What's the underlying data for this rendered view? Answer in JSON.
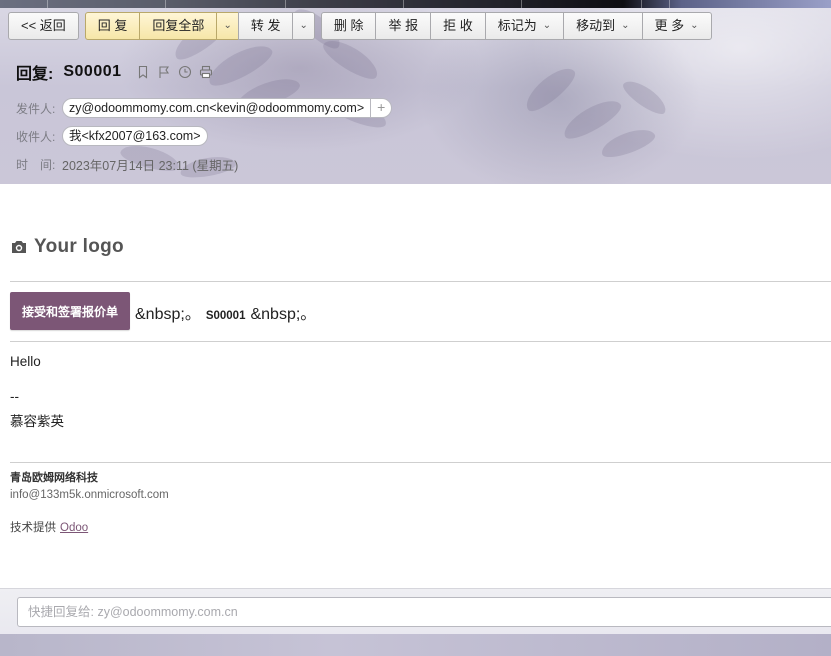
{
  "toolbar": {
    "back": "<< 返回",
    "reply": "回 复",
    "reply_all": "回复全部",
    "forward": "转 发",
    "delete": "删 除",
    "report": "举 报",
    "reject": "拒 收",
    "mark_as": "标记为",
    "move_to": "移动到",
    "more": "更 多",
    "caret": "⌄"
  },
  "mail": {
    "title_prefix": "回复:",
    "subject": "S00001",
    "icons": [
      "bookmark-icon",
      "flag-icon",
      "clock-icon",
      "print-icon"
    ],
    "from_label": "发件人:",
    "from_value": "zy@odoommomy.com.cn<kevin@odoommomy.com>",
    "add": "+",
    "to_label": "收件人:",
    "to_value": "我<kfx2007@163.com>",
    "time_label": "时　间:",
    "time_value": "2023年07月14日 23:11 (星期五)"
  },
  "body": {
    "logo_text": "Your logo",
    "accept_button": "接受和签署报价单",
    "nbsp_before": "&nbsp;。",
    "order_ref": "S00001",
    "nbsp_after": "&nbsp;。",
    "greeting": "Hello",
    "sig_dash": "--",
    "sig_name": "慕容紫英",
    "company_name": "青岛欧姆网络科技",
    "company_email": "info@133m5k.onmicrosoft.com",
    "powered_prefix": "技术提供",
    "powered_link": "Odoo"
  },
  "quick_reply": {
    "placeholder": "快捷回复给: zy@odoommomy.com.cn"
  }
}
